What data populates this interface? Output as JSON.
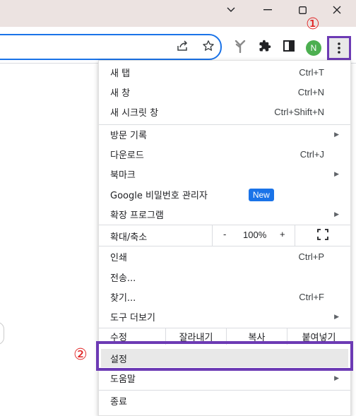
{
  "window": {
    "chevron_icon": "chevron-down-icon",
    "minimize_icon": "minimize-icon",
    "maximize_icon": "maximize-icon",
    "close_icon": "close-icon"
  },
  "toolbar": {
    "profile_initial": "N",
    "icons": [
      "share-icon",
      "star-icon",
      "extension-tree-icon",
      "puzzle-icon",
      "sidepanel-icon",
      "more-vert-icon"
    ]
  },
  "annotations": {
    "step1": "①",
    "step2": "②",
    "highlight_color": "#6c3ab4",
    "number_color": "#e02020"
  },
  "menu": {
    "new_tab": "새 탭",
    "new_tab_shortcut": "Ctrl+T",
    "new_window": "새 창",
    "new_window_shortcut": "Ctrl+N",
    "incognito": "새 시크릿 창",
    "incognito_shortcut": "Ctrl+Shift+N",
    "history": "방문 기록",
    "downloads": "다운로드",
    "downloads_shortcut": "Ctrl+J",
    "bookmarks": "북마크",
    "password_manager": "Google 비밀번호 관리자",
    "new_badge": "New",
    "extensions": "확장 프로그램",
    "zoom_label": "확대/축소",
    "zoom_minus": "-",
    "zoom_value": "100%",
    "zoom_plus": "+",
    "print": "인쇄",
    "print_shortcut": "Ctrl+P",
    "cast": "전송...",
    "find": "찾기...",
    "find_shortcut": "Ctrl+F",
    "more_tools": "도구 더보기",
    "edit_label": "수정",
    "cut": "잘라내기",
    "copy": "복사",
    "paste": "붙여넣기",
    "settings": "설정",
    "help": "도움말",
    "exit": "종료",
    "accent": "#1a73e8"
  }
}
